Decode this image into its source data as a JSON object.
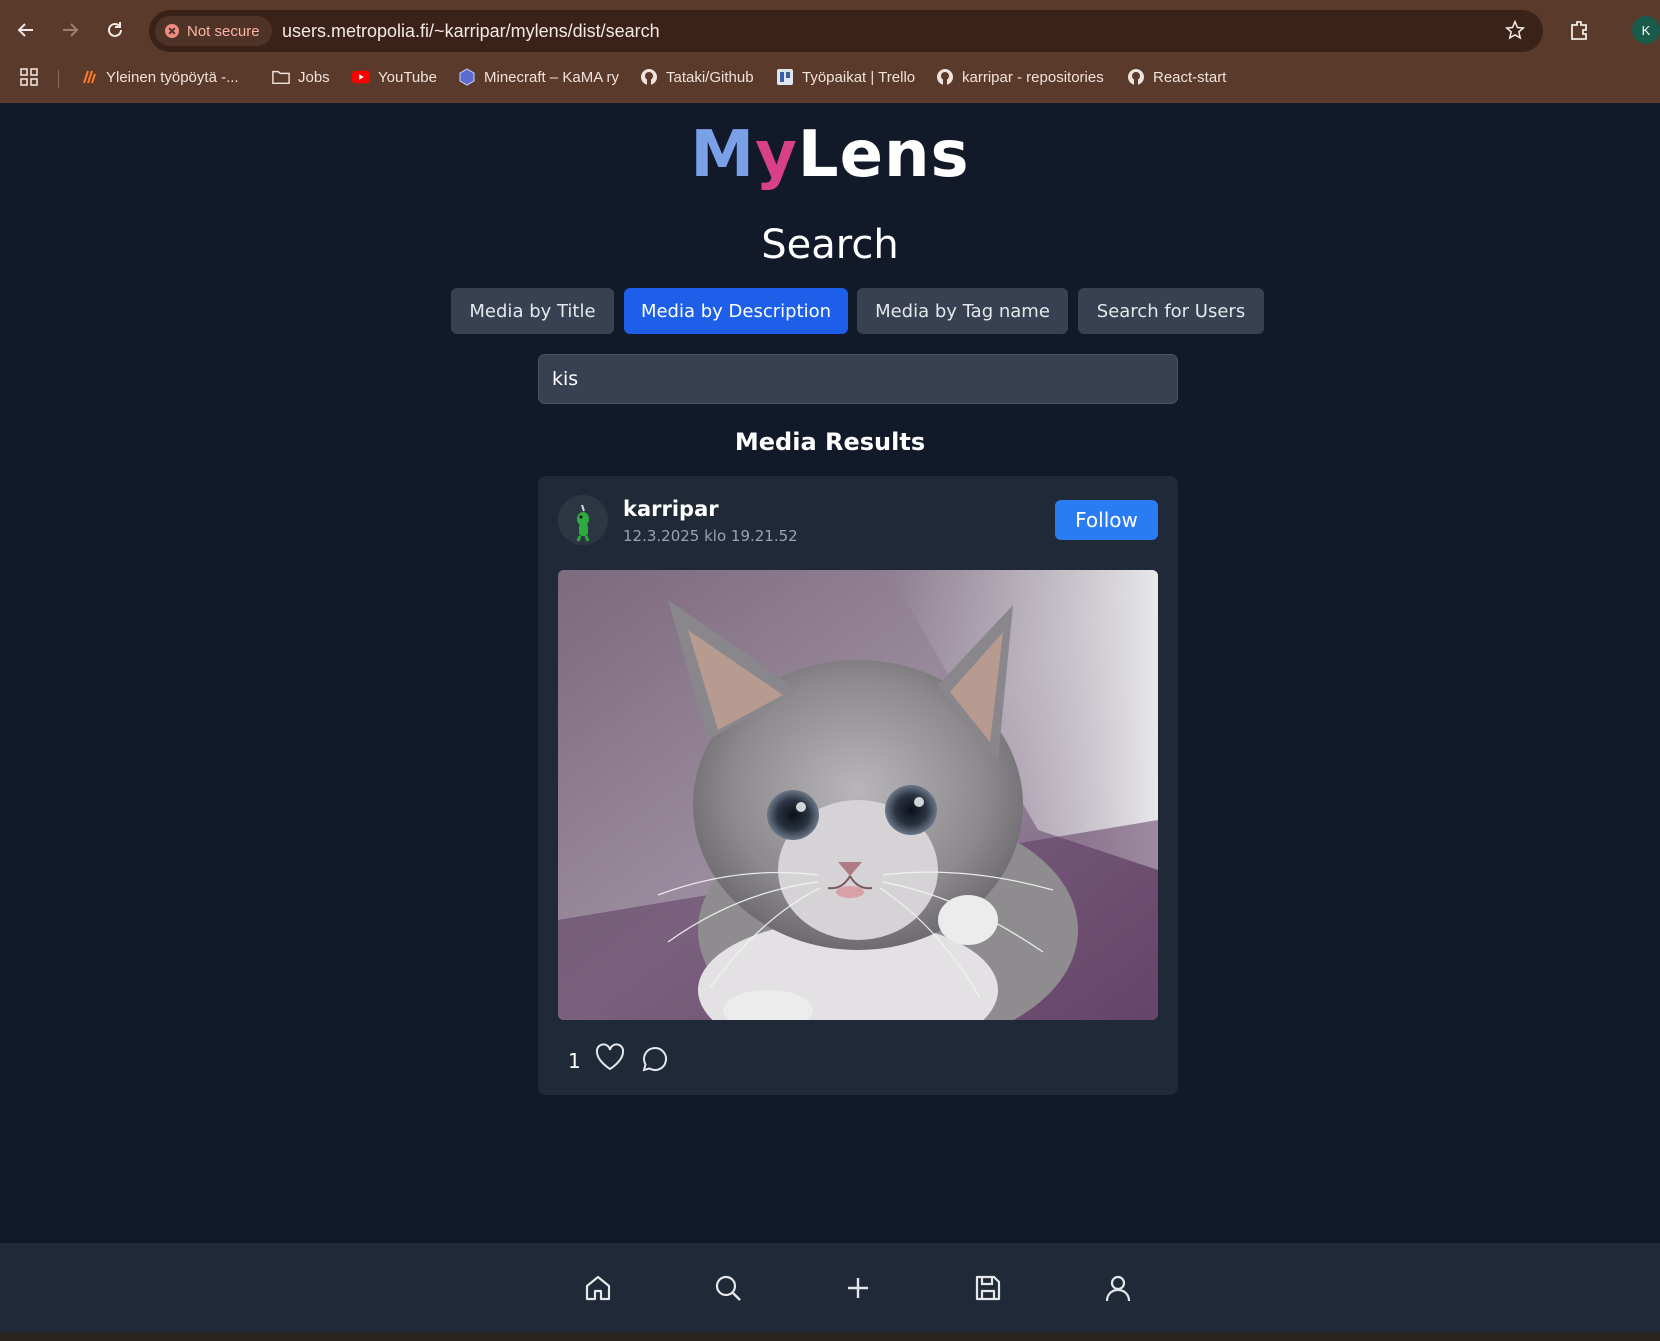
{
  "browser": {
    "security_label": "Not secure",
    "url": "users.metropolia.fi/~karripar/mylens/dist/search",
    "profile_initial": "K",
    "bookmarks": [
      {
        "label": "Yleinen työpöytä -...",
        "icon": "fire-icon"
      },
      {
        "label": "Jobs",
        "icon": "folder-icon"
      },
      {
        "label": "YouTube",
        "icon": "youtube-icon"
      },
      {
        "label": "Minecraft – KaMA ry",
        "icon": "cube-icon"
      },
      {
        "label": "Tataki/Github",
        "icon": "github-icon"
      },
      {
        "label": "Työpaikat | Trello",
        "icon": "trello-icon"
      },
      {
        "label": "karripar - repositories",
        "icon": "github-icon"
      },
      {
        "label": "React-start",
        "icon": "github-icon"
      }
    ]
  },
  "logo": {
    "part1": "M",
    "part2": "y",
    "part3": "Lens"
  },
  "page": {
    "title": "Search"
  },
  "tabs": [
    {
      "label": "Media by Title",
      "active": false
    },
    {
      "label": "Media by Description",
      "active": true
    },
    {
      "label": "Media by Tag name",
      "active": false
    },
    {
      "label": "Search for Users",
      "active": false
    }
  ],
  "search": {
    "value": "kis"
  },
  "results": {
    "title": "Media Results",
    "item": {
      "username": "karripar",
      "date": "12.3.2025 klo 19.21.52",
      "follow_label": "Follow",
      "likes": "1"
    }
  },
  "colors": {
    "page_bg": "#121a2a",
    "card_bg": "#1f2937",
    "accent": "#1d5fe8",
    "follow": "#2a7cf2"
  }
}
